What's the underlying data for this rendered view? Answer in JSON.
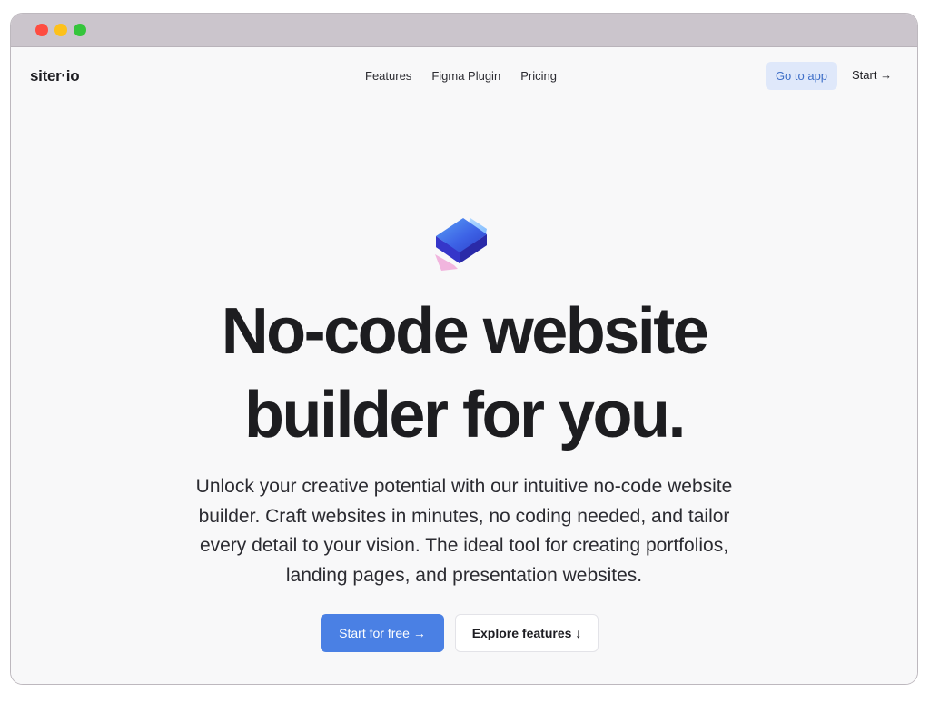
{
  "browser": {
    "controls": [
      "close",
      "minimize",
      "maximize"
    ]
  },
  "nav": {
    "logo": "siter·io",
    "links": [
      "Features",
      "Figma Plugin",
      "Pricing"
    ],
    "go_to_app": "Go to app",
    "start": "Start →"
  },
  "hero": {
    "icon": "siter-logo-icon",
    "headline_line1": "No-code website",
    "headline_line2": "builder for you.",
    "subtext": "Unlock your creative potential with our intuitive no-code website builder. Craft websites in minutes, no coding needed, and tailor every detail to your vision. The ideal tool for creating portfolios, landing pages, and presentation websites.",
    "cta_primary": "Start for free →",
    "cta_secondary": "Explore features ↓"
  },
  "colors": {
    "accent": "#4a80e4",
    "go_to_app_bg": "#dfe8fa",
    "page_bg": "#f8f8f9",
    "titlebar": "#cbc5cc"
  }
}
